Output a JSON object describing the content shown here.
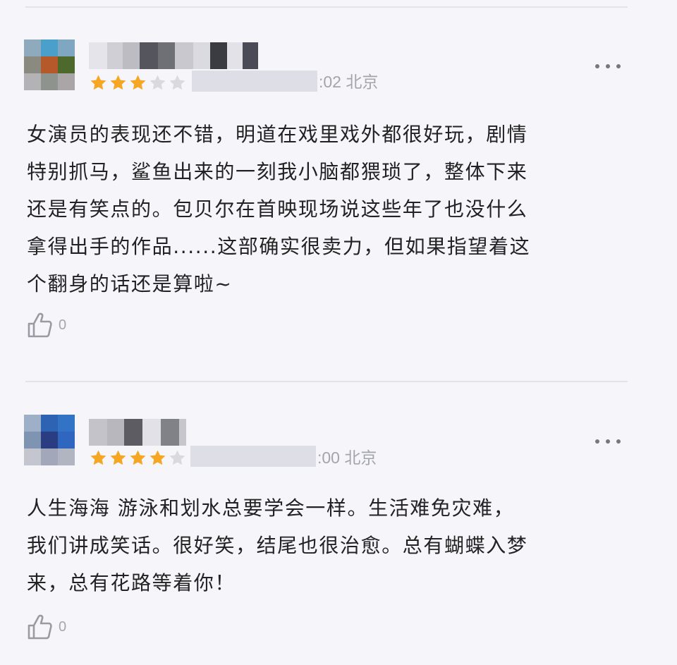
{
  "colors": {
    "star_filled": "#f5a623",
    "star_empty": "#d9d9df",
    "text": "#222222",
    "meta_text": "#a4a4ac",
    "background": "#f5f5fa"
  },
  "icons": {
    "more": "more-horizontal-icon",
    "like": "thumbs-up-icon",
    "star": "star-icon"
  },
  "reviews": [
    {
      "rating": 3,
      "rating_max": 5,
      "time_suffix": ":02 北京",
      "content": "女演员的表现还不错，明道在戏里戏外都很好玩，剧情\n特别抓马，鲨鱼出来的一刻我小脑都猥琐了，整体下来\n还是有笑点的。包贝尔在首映现场说这些年了也没什么\n拿得出手的作品......这部确实很卖力，但如果指望着这\n个翻身的话还是算啦~",
      "likes": "0"
    },
    {
      "rating": 4,
      "rating_max": 5,
      "time_suffix": ":00 北京",
      "content": "人生海海 游泳和划水总要学会一样。生活难免灾难，\n我们讲成笑话。很好笑，结尾也很治愈。总有蝴蝶入梦\n来，总有花路等着你！",
      "likes": "0"
    }
  ]
}
